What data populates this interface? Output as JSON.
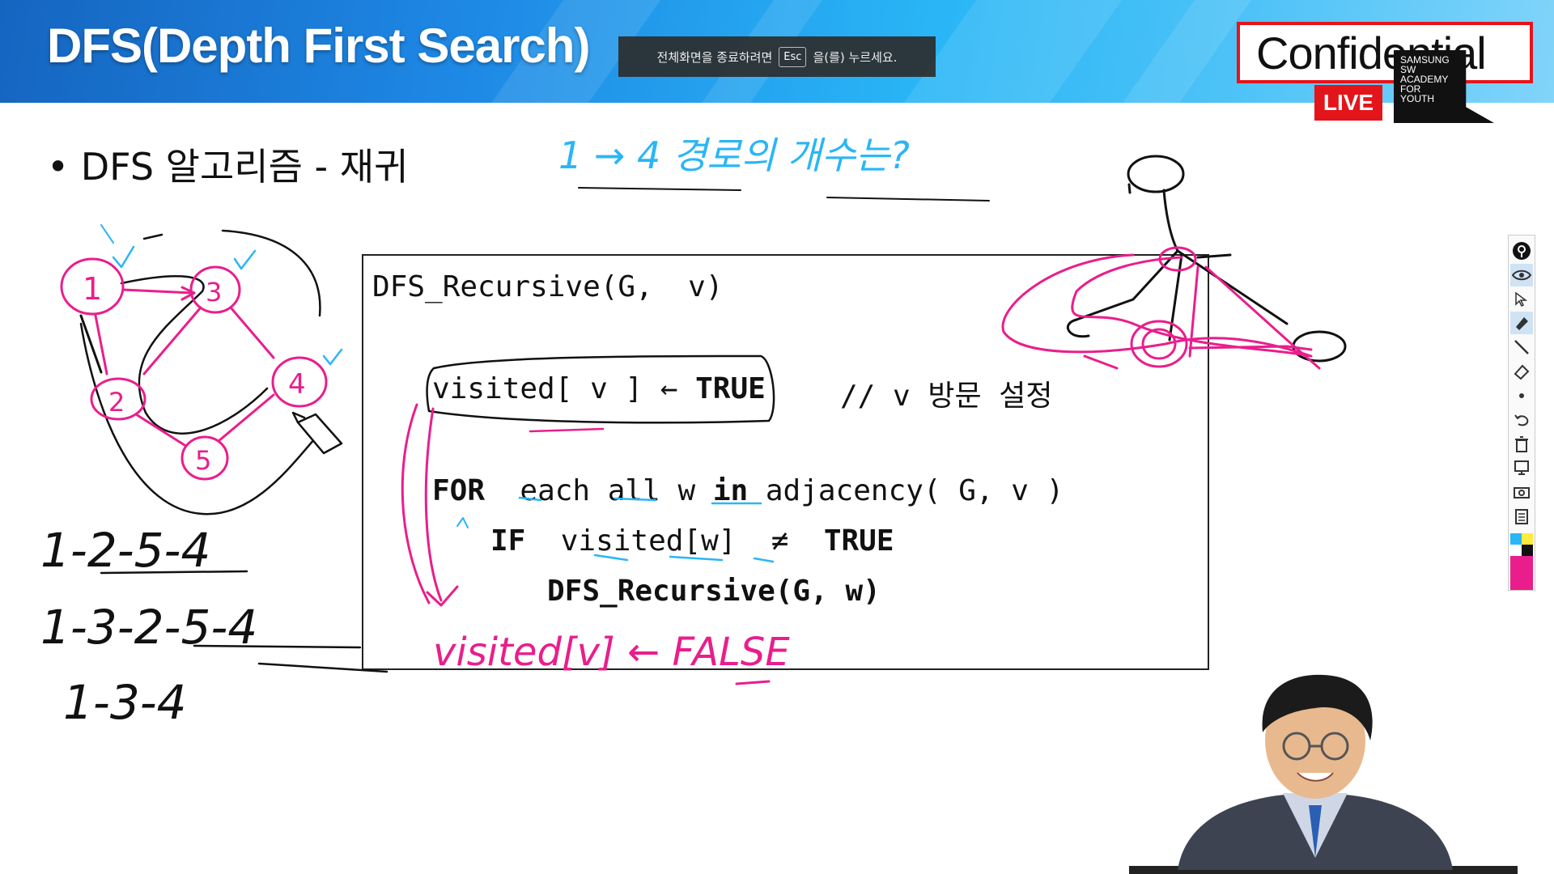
{
  "header": {
    "title": "DFS(Depth First Search)",
    "fullscreen_notice": {
      "before": "전체화면을 종료하려면",
      "key": "Esc",
      "after": "을(를) 누르세요."
    },
    "confidential": "Confidential",
    "live": "LIVE",
    "academy_lines": [
      "SAMSUNG",
      "SW",
      "ACADEMY",
      "FOR",
      "YOUTH"
    ]
  },
  "slide": {
    "bullet": "DFS 알고리즘 - 재귀",
    "code": {
      "signature": "DFS_Recursive(G,  v)",
      "visited_prefix": "visited[ v ] ← ",
      "visited_true": "TRUE",
      "visited_comment": "// v 방문 설정",
      "for_kw": "FOR",
      "for_mid": "each all w ",
      "in_kw": "in",
      "for_rest": " adjacency( G, v )",
      "if_kw": "IF",
      "if_cond": "visited[w]  ≠  ",
      "if_true": "TRUE",
      "call": "DFS_Recursive(G, w)"
    }
  },
  "handwriting": {
    "question": "1 → 4  경로의 개수는?",
    "paths": [
      "1-2-5-4",
      "1-3-2-5-4",
      "1-3-4"
    ],
    "visited_false": "visited[v] ← FALSE",
    "graph_nodes": [
      "1",
      "2",
      "3",
      "4",
      "5"
    ]
  },
  "toolbar": {
    "tools": [
      "pin-icon",
      "eye-icon",
      "cursor-icon",
      "highlighter-icon",
      "pen-icon",
      "eraser-icon",
      "dot-icon",
      "undo-icon",
      "trash-icon",
      "screen-icon",
      "camera-icon",
      "clipboard-icon"
    ],
    "colors": [
      "#29b6f6",
      "#ffeb3b",
      "#111111",
      "#e91e8c"
    ]
  }
}
